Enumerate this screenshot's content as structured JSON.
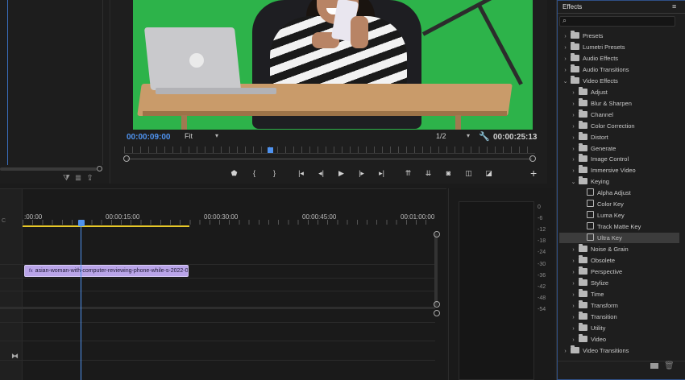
{
  "monitor": {
    "current_timecode": "00:00:09:00",
    "duration_timecode": "00:00:25:13",
    "zoom_value": "Fit",
    "resolution_value": "1/2",
    "transport": [
      {
        "name": "add-marker-button",
        "glyph": "⬟"
      },
      {
        "name": "mark-in-button",
        "glyph": "{"
      },
      {
        "name": "mark-out-button",
        "glyph": "}"
      },
      {
        "name": "go-to-in-button",
        "glyph": "|◂"
      },
      {
        "name": "step-back-button",
        "glyph": "◂|"
      },
      {
        "name": "play-button",
        "glyph": "▶"
      },
      {
        "name": "step-forward-button",
        "glyph": "|▸"
      },
      {
        "name": "go-to-out-button",
        "glyph": "▸|"
      },
      {
        "name": "lift-button",
        "glyph": "⇈"
      },
      {
        "name": "extract-button",
        "glyph": "⇊"
      },
      {
        "name": "export-frame-button",
        "glyph": "◙"
      },
      {
        "name": "compare-view-button",
        "glyph": "◫"
      },
      {
        "name": "toggle-proxies-button",
        "glyph": "◪"
      }
    ],
    "add_glyph": "+"
  },
  "timeline": {
    "ruler_labels": [
      ":00:00",
      "00:00:15:00",
      "00:00:30:00",
      "00:00:45:00",
      "00:01:00:00"
    ],
    "clip_name": "asian-woman-with-computer-reviewing-phone-while-s-2022-0",
    "clip_fx_label": "fx",
    "track_tool_label": "C"
  },
  "meter": {
    "scale": [
      "0",
      "-6",
      "-12",
      "-18",
      "-24",
      "-30",
      "-36",
      "-42",
      "-48",
      "-54"
    ]
  },
  "effects": {
    "title": "Effects",
    "search_placeholder": "",
    "items": [
      {
        "label": "Presets",
        "level": 0,
        "type": "folder",
        "expanded": false
      },
      {
        "label": "Lumetri Presets",
        "level": 0,
        "type": "folder",
        "expanded": false
      },
      {
        "label": "Audio Effects",
        "level": 0,
        "type": "folder",
        "expanded": false
      },
      {
        "label": "Audio Transitions",
        "level": 0,
        "type": "folder",
        "expanded": false
      },
      {
        "label": "Video Effects",
        "level": 0,
        "type": "folder",
        "expanded": true
      },
      {
        "label": "Adjust",
        "level": 1,
        "type": "folder",
        "expanded": false
      },
      {
        "label": "Blur & Sharpen",
        "level": 1,
        "type": "folder",
        "expanded": false
      },
      {
        "label": "Channel",
        "level": 1,
        "type": "folder",
        "expanded": false
      },
      {
        "label": "Color Correction",
        "level": 1,
        "type": "folder",
        "expanded": false
      },
      {
        "label": "Distort",
        "level": 1,
        "type": "folder",
        "expanded": false
      },
      {
        "label": "Generate",
        "level": 1,
        "type": "folder",
        "expanded": false
      },
      {
        "label": "Image Control",
        "level": 1,
        "type": "folder",
        "expanded": false
      },
      {
        "label": "Immersive Video",
        "level": 1,
        "type": "folder",
        "expanded": false
      },
      {
        "label": "Keying",
        "level": 1,
        "type": "folder",
        "expanded": true
      },
      {
        "label": "Alpha Adjust",
        "level": 2,
        "type": "effect"
      },
      {
        "label": "Color Key",
        "level": 2,
        "type": "effect"
      },
      {
        "label": "Luma Key",
        "level": 2,
        "type": "effect"
      },
      {
        "label": "Track Matte Key",
        "level": 2,
        "type": "effect"
      },
      {
        "label": "Ultra Key",
        "level": 2,
        "type": "effect",
        "selected": true
      },
      {
        "label": "Noise & Grain",
        "level": 1,
        "type": "folder",
        "expanded": false
      },
      {
        "label": "Obsolete",
        "level": 1,
        "type": "folder",
        "expanded": false
      },
      {
        "label": "Perspective",
        "level": 1,
        "type": "folder",
        "expanded": false
      },
      {
        "label": "Stylize",
        "level": 1,
        "type": "folder",
        "expanded": false
      },
      {
        "label": "Time",
        "level": 1,
        "type": "folder",
        "expanded": false
      },
      {
        "label": "Transform",
        "level": 1,
        "type": "folder",
        "expanded": false
      },
      {
        "label": "Transition",
        "level": 1,
        "type": "folder",
        "expanded": false
      },
      {
        "label": "Utility",
        "level": 1,
        "type": "folder",
        "expanded": false
      },
      {
        "label": "Video",
        "level": 1,
        "type": "folder",
        "expanded": false
      },
      {
        "label": "Video Transitions",
        "level": 0,
        "type": "folder",
        "expanded": false
      }
    ]
  },
  "colors": {
    "accent_blue": "#4f93f0",
    "work_area_yellow": "#e8c929",
    "clip_purple": "#b9a4e8",
    "chroma_green": "#2db34a"
  }
}
